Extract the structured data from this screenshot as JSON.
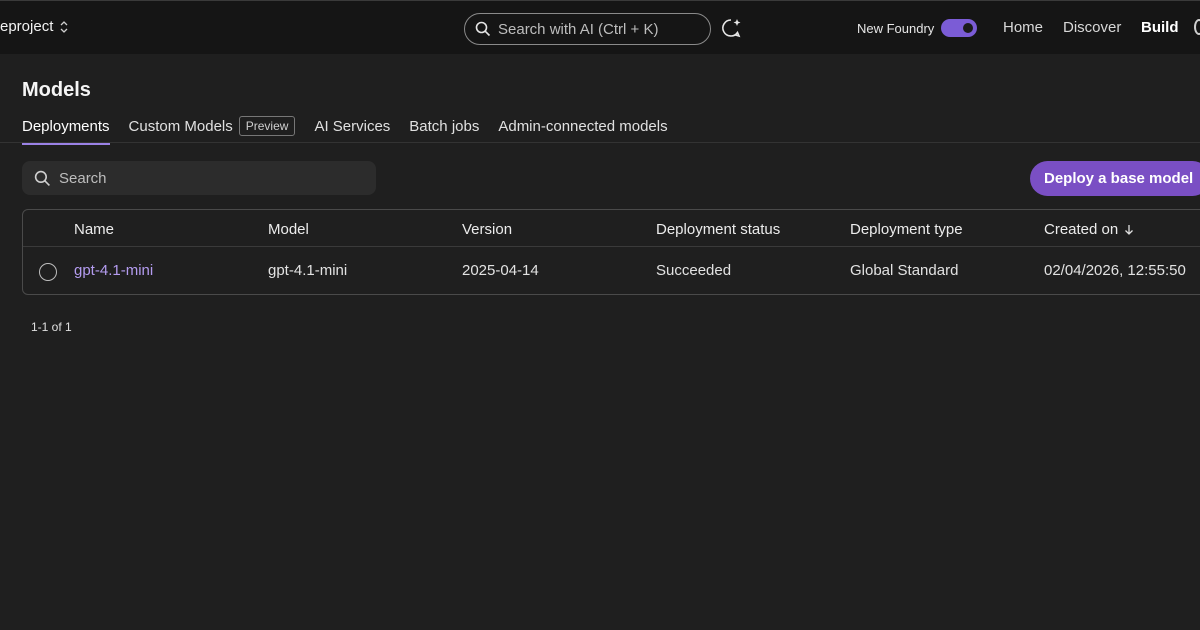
{
  "header": {
    "project_name": "eproject",
    "search_placeholder": "Search with AI (Ctrl + K)",
    "new_foundry_label": "New Foundry",
    "new_foundry_enabled": true,
    "nav": [
      "Home",
      "Discover",
      "Build"
    ],
    "active_nav": "Build",
    "accent_color": "#7b5cd6"
  },
  "page": {
    "title": "Models",
    "tabs": [
      {
        "label": "Deployments",
        "active": true
      },
      {
        "label": "Custom Models",
        "badge": "Preview"
      },
      {
        "label": "AI Services"
      },
      {
        "label": "Batch jobs"
      },
      {
        "label": "Admin-connected models"
      }
    ]
  },
  "toolbar": {
    "search_placeholder": "Search",
    "deploy_label": "Deploy a base model",
    "deploy_color": "#7a4fc4"
  },
  "table": {
    "columns": [
      "Name",
      "Model",
      "Version",
      "Deployment status",
      "Deployment type",
      "Created on"
    ],
    "sort_icon": "arrow-down-icon",
    "rows": [
      {
        "name": "gpt-4.1-mini",
        "model": "gpt-4.1-mini",
        "version": "2025-04-14",
        "status": "Succeeded",
        "type": "Global Standard",
        "created": "02/04/2026, 12:55:50"
      }
    ]
  },
  "pagination": {
    "text": "1-1 of 1"
  }
}
